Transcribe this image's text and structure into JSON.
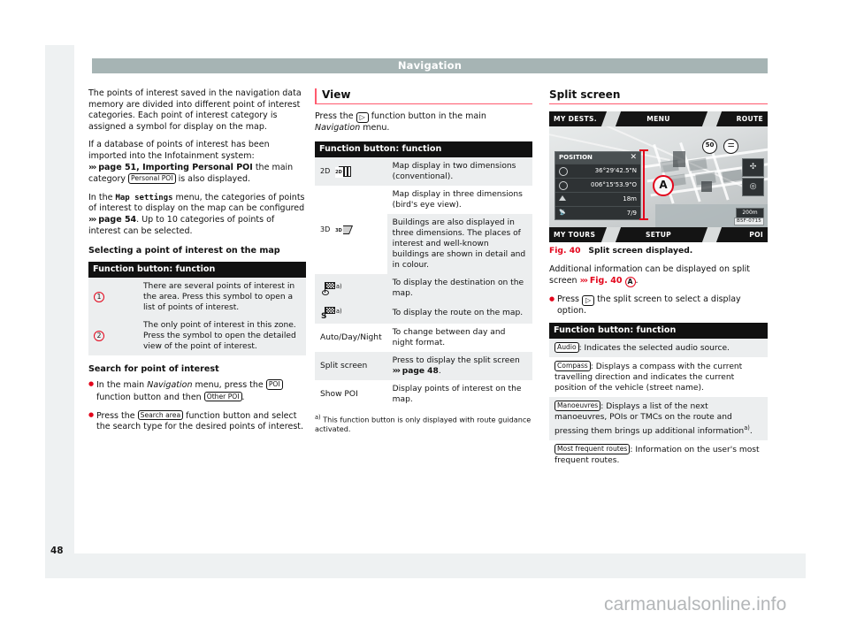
{
  "document": {
    "running_header": "Navigation",
    "page_number": "48",
    "watermark": "carmanualsonline.info"
  },
  "left_column": {
    "para_1": "The points of interest saved in the navigation data memory are divided into different point of interest categories. Each point of interest category is assigned a symbol for display on the map.",
    "para_2_a": "If a database of points of interest has been imported into the Infotainment system:",
    "para_2_xref": "page 51, Importing Personal POI",
    "para_2_b": "the main category",
    "para_2_btn": "Personal POI",
    "para_2_c": "is also displayed.",
    "para_3_a": "In the",
    "para_3_mono": "Map settings",
    "para_3_b": "menu, the categories of points of interest to display on the map can be configured",
    "para_3_xref": "page 54",
    "para_3_c": ". Up to 10 categories of points of interest can be selected.",
    "heading_select": "Selecting a point of interest on the map",
    "table": {
      "caption": "Function button: function",
      "rows": [
        {
          "marker": "1",
          "text": "There are several points of interest in the area. Press this symbol to open a list of points of interest."
        },
        {
          "marker": "2",
          "text": "The only point of interest in this zone. Press the symbol to open the detailed view of the point of interest."
        }
      ]
    },
    "heading_search": "Search for point of interest",
    "bullet_1_a": "In the main",
    "bullet_1_italic": "Navigation",
    "bullet_1_b": "menu, press the",
    "bullet_1_btn_1": "POI",
    "bullet_1_c": "function button and then",
    "bullet_1_btn_2": "Other POI",
    "bullet_1_d": ".",
    "bullet_2_a": "Press the",
    "bullet_2_btn": "Search area",
    "bullet_2_b": "function button and select the search type for the desired points of interest."
  },
  "middle_column": {
    "heading": "View",
    "intro_a": "Press the",
    "intro_icon": "play-button-glyph",
    "intro_b": "function button in the main",
    "intro_italic": "Navigation",
    "intro_c": "menu.",
    "table": {
      "caption": "Function button: function",
      "rows": [
        {
          "key": "2D",
          "icon": "map-2d-icon",
          "text": "Map display in two dimensions (conventional)."
        },
        {
          "key": "3D",
          "icon": "map-3d-icon",
          "text": "Map display in three dimensions (bird's eye view)."
        },
        {
          "key": "",
          "icon": "",
          "text": "Buildings are also displayed in three dimensions. The places of interest and well-known buildings are shown in detail and in colour."
        },
        {
          "key": "",
          "icon": "destination-flag-icon",
          "footnote": "a)",
          "text": "To display the destination on the map."
        },
        {
          "key": "",
          "icon": "route-flag-icon",
          "footnote": "a)",
          "text": "To display the route on the map."
        },
        {
          "key": "Auto/Day/Night",
          "icon": "",
          "text": "To change between day and night format."
        },
        {
          "key": "Split screen",
          "icon": "",
          "text": "Press to display the split screen",
          "xref": "page 48",
          "text_tail": "."
        },
        {
          "key": "Show POI",
          "icon": "",
          "text": "Display points of interest on the map."
        }
      ]
    },
    "footnote_marker": "a)",
    "footnote_text": "This function button is only displayed with route guidance activated."
  },
  "right_column": {
    "heading": "Split screen",
    "figure": {
      "caption_number": "Fig. 40",
      "caption_text": "Split screen displayed.",
      "code_tag": "B5F-0715",
      "top_bar": {
        "left": "MY DESTS.",
        "center": "MENU",
        "right": "ROUTE"
      },
      "bottom_bar": {
        "left": "MY TOURS",
        "center": "SETUP",
        "right": "POI"
      },
      "position_panel": {
        "title": "POSITION",
        "close": "close-icon",
        "rows": [
          {
            "icon": "latitude-icon",
            "value": "36°29'42.5\"N"
          },
          {
            "icon": "longitude-icon",
            "value": "006°15'53.9\"O"
          },
          {
            "icon": "altitude-icon",
            "value": "18m"
          },
          {
            "icon": "gps-icon",
            "value": "7/9"
          }
        ]
      },
      "callout_label": "A",
      "speed_limit": "50",
      "no_overtaking": "no-overtaking-icon",
      "map_scale": "200m"
    },
    "para_a": "Additional information can be displayed on split screen",
    "para_xref": "Fig. 40",
    "para_callout": "A",
    "para_b": ".",
    "bullet_a": "Press",
    "bullet_icon": "play-button-glyph",
    "bullet_b": "the split screen to select a display option.",
    "table": {
      "caption": "Function button: function",
      "rows": [
        {
          "button": "Audio",
          "text": ": Indicates the selected audio source."
        },
        {
          "button": "Compass",
          "text": ": Displays a compass with the current travelling direction and indicates the current position of the vehicle (street name)."
        },
        {
          "button": "Manoeuvres",
          "text": ": Displays a list of the next manoeuvres, POIs or TMCs on the route and pressing them brings up additional information",
          "footnote": "a)",
          "text_tail": "."
        },
        {
          "button": "Most frequent routes",
          "text": ": Information on the user's most frequent routes."
        }
      ]
    }
  },
  "colors": {
    "accent_red": "#e3051b",
    "rule_pink": "#ff5a6e",
    "header_grey": "#a6b4b4",
    "table_header": "#111111",
    "shade": "#eceeef",
    "page_mat": "#eef1f2"
  }
}
